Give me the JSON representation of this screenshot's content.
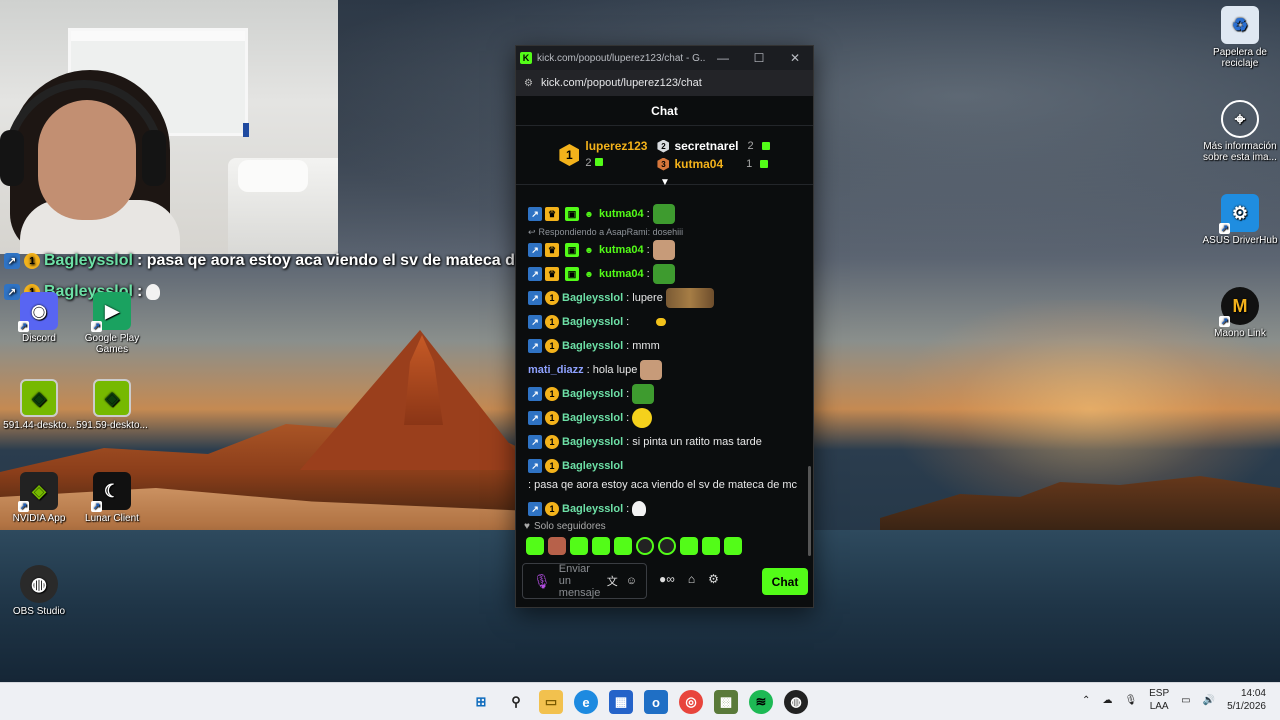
{
  "overlay_chat": [
    {
      "user": "Bagleysslol",
      "text": ": pasa qe aora estoy aca viendo el sv de mateca de mc"
    },
    {
      "user": "Bagleysslol",
      "text": ":"
    }
  ],
  "desktop_icons_left": [
    {
      "label": "Discord",
      "icon": "discord-icon"
    },
    {
      "label": "Google Play Games",
      "icon": "google-play-games-icon"
    },
    {
      "label": "591.44-deskto...",
      "icon": "nvidia-installer-icon"
    },
    {
      "label": "591.59-deskto...",
      "icon": "nvidia-installer-icon"
    },
    {
      "label": "NVIDIA App",
      "icon": "nvidia-app-icon"
    },
    {
      "label": "Lunar Client",
      "icon": "lunar-client-icon"
    },
    {
      "label": "OBS Studio",
      "icon": "obs-studio-icon"
    }
  ],
  "desktop_icons_right": [
    {
      "label": "Papelera de reciclaje",
      "icon": "recycle-bin-icon"
    },
    {
      "label": "Más información sobre esta ima...",
      "icon": "info-icon"
    },
    {
      "label": "ASUS DriverHub",
      "icon": "asus-driverhub-icon"
    },
    {
      "label": "Maono Link",
      "icon": "maono-link-icon"
    }
  ],
  "browser": {
    "title": "kick.com/popout/luperez123/chat - G...",
    "url": "kick.com/popout/luperez123/chat",
    "window_controls": {
      "minimize": "—",
      "maximize": "☐",
      "close": "✕"
    }
  },
  "chat": {
    "header": "Chat",
    "leaderboard": {
      "first": {
        "rank": "1",
        "name": "luperez123",
        "count": "2"
      },
      "second": {
        "rank": "2",
        "name": "secretnarel",
        "count": "2"
      },
      "third": {
        "rank": "3",
        "name": "kutma04",
        "count": "1"
      }
    },
    "messages": [
      {
        "user": "kutma04",
        "text": ":"
      },
      {
        "reply_to": "Respondiendo a AsapRami: dosehiii"
      },
      {
        "user": "kutma04",
        "text": ":"
      },
      {
        "user": "kutma04",
        "text": ":"
      },
      {
        "user": "Bagleysslol",
        "text": ": lupere"
      },
      {
        "user": "Bagleysslol",
        "text": ":"
      },
      {
        "user": "Bagleysslol",
        "text": ": mmm"
      },
      {
        "user": "mati_diazz",
        "text": ": hola lupe"
      },
      {
        "user": "Bagleysslol",
        "text": ":"
      },
      {
        "user": "Bagleysslol",
        "text": ":"
      },
      {
        "user": "Bagleysslol",
        "text": ": si pinta un ratito mas tarde"
      },
      {
        "user": "Bagleysslol",
        "text": ": pasa qe aora estoy aca viendo el sv de mateca de mc"
      },
      {
        "user": "Bagleysslol",
        "text": ":"
      }
    ],
    "followers_only": "Solo seguidores",
    "input_placeholder": "Enviar un mensaje",
    "send_label": "Chat"
  },
  "taskbar": {
    "lang_top": "ESP",
    "lang_bottom": "LAA",
    "time": "14:04",
    "date": "5/1/2026"
  },
  "colors": {
    "kick_green": "#53fc18",
    "sub_gold": "#f3b21b",
    "bot_blue": "#2f73c4"
  }
}
